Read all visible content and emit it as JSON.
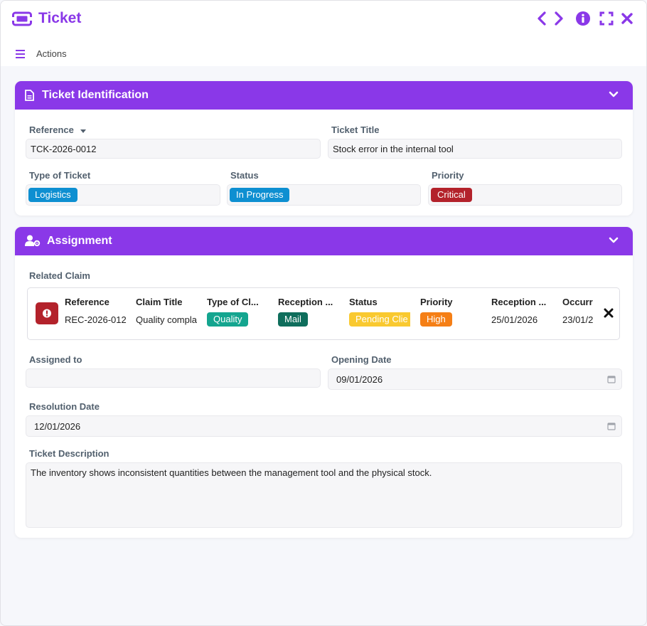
{
  "window": {
    "title": "Ticket"
  },
  "toolbar": {
    "actions_label": "Actions"
  },
  "identification": {
    "title": "Ticket Identification",
    "reference_label": "Reference",
    "reference_value": "TCK-2026-0012",
    "ticket_title_label": "Ticket Title",
    "ticket_title_value": "Stock error in the internal tool",
    "type_label": "Type of Ticket",
    "type_value": "Logistics",
    "status_label": "Status",
    "status_value": "In Progress",
    "priority_label": "Priority",
    "priority_value": "Critical"
  },
  "assignment": {
    "title": "Assignment",
    "related_claim_label": "Related Claim",
    "claim": {
      "headers": [
        "Reference",
        "Claim Title",
        "Type of Cl...",
        "Reception ...",
        "Status",
        "Priority",
        "Reception ...",
        "Occurr"
      ],
      "reference": "REC-2026-012",
      "claim_title": "Quality compla",
      "type": "Quality",
      "reception_channel": "Mail",
      "status": "Pending Clie",
      "priority": "High",
      "reception_date": "25/01/2026",
      "occurrence_date": "23/01/2"
    },
    "assigned_to_label": "Assigned to",
    "assigned_to_value": "",
    "opening_date_label": "Opening Date",
    "opening_date_value": "09/01/2026",
    "resolution_date_label": "Resolution Date",
    "resolution_date_value": "12/01/2026",
    "description_label": "Ticket Description",
    "description_value": "The inventory shows inconsistent quantities between the management tool and the physical stock."
  },
  "colors": {
    "accent": "#8a38e8",
    "logistics": "#0e8fd1",
    "in_progress": "#0e8fd1",
    "critical": "#b3222b",
    "quality": "#14a58f",
    "mail": "#0f6e5c",
    "pending": "#f9c930",
    "high": "#f57f16"
  },
  "icons": [
    "ticket-icon",
    "chevron-left-icon",
    "chevron-right-icon",
    "info-icon",
    "fullscreen-icon",
    "close-icon",
    "menu-icon",
    "document-icon",
    "user-gear-icon",
    "chevron-down-icon",
    "alert-icon",
    "calendar-icon",
    "caret-down-icon"
  ]
}
